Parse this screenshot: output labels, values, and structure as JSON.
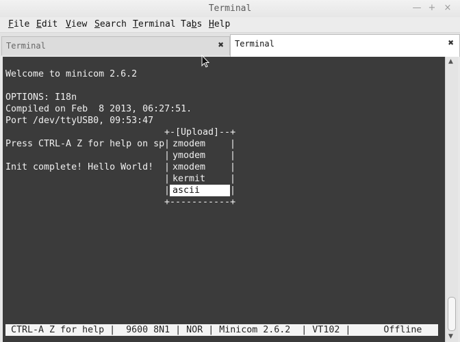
{
  "window": {
    "title": "Terminal",
    "controls": {
      "minimize": "—",
      "maximize": "+",
      "close": "×"
    }
  },
  "menubar": [
    {
      "key": "F",
      "rest": "ile"
    },
    {
      "key": "E",
      "rest": "dit"
    },
    {
      "key": "V",
      "rest": "iew"
    },
    {
      "key": "S",
      "rest": "earch"
    },
    {
      "key": "T",
      "rest": "erminal"
    },
    {
      "pre": "Ta",
      "key": "b",
      "rest": "s"
    },
    {
      "key": "H",
      "rest": "elp"
    }
  ],
  "tabs": [
    {
      "label": "Terminal",
      "active": false
    },
    {
      "label": "Terminal",
      "active": true
    }
  ],
  "terminal": {
    "lines": [
      "Welcome to minicom 2.6.2",
      "",
      "OPTIONS: I18n",
      "Compiled on Feb  8 2013, 06:27:51.",
      "Port /dev/ttyUSB0, 09:53:47",
      "",
      "Press CTRL-A Z for help on sp",
      "",
      "Init complete! Hello World!"
    ],
    "upload_popup": {
      "top_border": "+-[Upload]--+",
      "bottom_border": "+-----------+",
      "items": [
        "zmodem",
        "ymodem",
        "xmodem",
        "kermit",
        "ascii"
      ],
      "selected": "ascii"
    },
    "status_line": " CTRL-A Z for help |  9600 8N1 | NOR | Minicom 2.6.2  | VT102 |      Offline"
  },
  "colors": {
    "terminal_bg": "#3b3b3b",
    "terminal_fg": "#f0f0f0",
    "statusbar_bg": "#f4f4f4"
  },
  "icons": {
    "tab_close": "close-icon",
    "scroll_up": "arrow-up-icon",
    "scroll_down": "arrow-down-icon",
    "pointer": "mouse-pointer-icon"
  }
}
